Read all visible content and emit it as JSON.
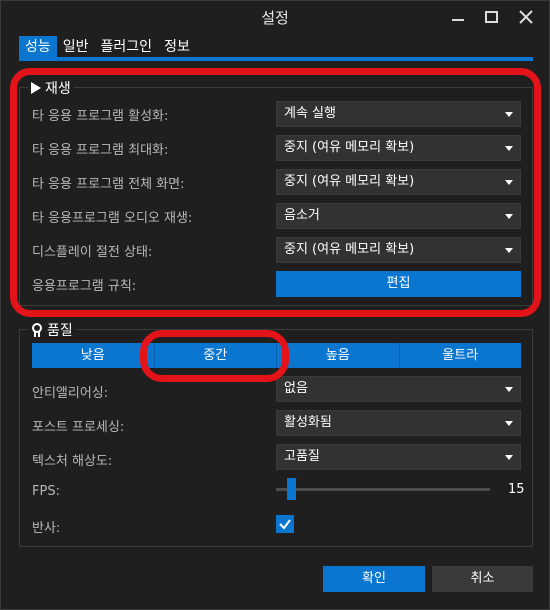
{
  "window": {
    "title": "설정",
    "controls": [
      "minimize",
      "maximize",
      "close"
    ]
  },
  "tabs": [
    {
      "label": "성능",
      "active": true
    },
    {
      "label": "일반",
      "active": false
    },
    {
      "label": "플러그인",
      "active": false
    },
    {
      "label": "정보",
      "active": false
    }
  ],
  "playback": {
    "title": "재생",
    "icon": "play-icon",
    "rows": [
      {
        "label": "타 응용 프로그램 활성화:",
        "value": "계속 실행"
      },
      {
        "label": "타 응용 프로그램 최대화:",
        "value": "중지 (여유 메모리 확보)"
      },
      {
        "label": "타 응용 프로그램 전체 화면:",
        "value": "중지 (여유 메모리 확보)"
      },
      {
        "label": "타 응용프로그램 오디오 재생:",
        "value": "음소거"
      },
      {
        "label": "디스플레이 절전 상태:",
        "value": "중지 (여유 메모리 확보)"
      }
    ],
    "rules_label": "응용프로그램 규칙:",
    "edit_button": "편집"
  },
  "quality": {
    "title": "품질",
    "icon": "award-icon",
    "presets": [
      "낮음",
      "중간",
      "높음",
      "울트라"
    ],
    "selected_preset": "중간",
    "antialiasing_label": "안티앨리어싱:",
    "antialiasing_value": "없음",
    "postprocessing_label": "포스트 프로세싱:",
    "postprocessing_value": "활성화됨",
    "texture_label": "텍스처 해상도:",
    "texture_value": "고품질",
    "fps_label": "FPS:",
    "fps_value": "15",
    "reflection_label": "반사:",
    "reflection_checked": true
  },
  "footer": {
    "ok": "확인",
    "cancel": "취소"
  },
  "colors": {
    "accent": "#0a76d0",
    "background": "#1f1f1f",
    "annotation": "#e3131a"
  }
}
